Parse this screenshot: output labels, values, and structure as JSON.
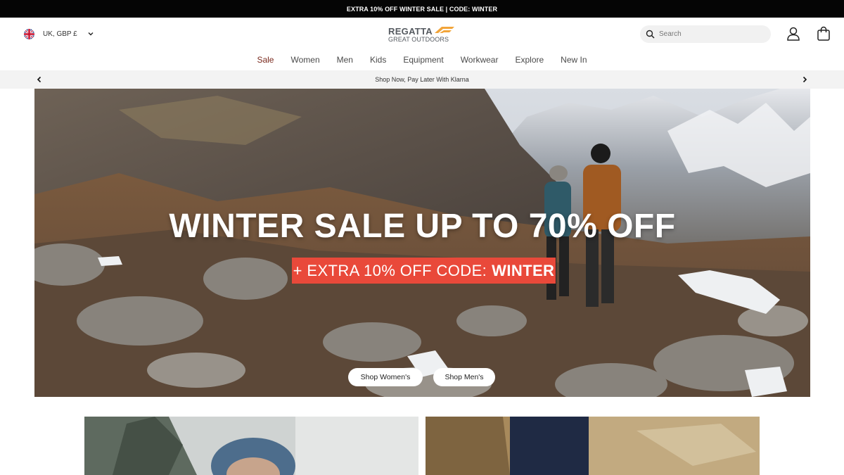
{
  "promo": {
    "text": "EXTRA 10% OFF WINTER SALE | CODE: WINTER"
  },
  "header": {
    "locale": "UK, GBP £",
    "logo": {
      "line1": "REGATTA",
      "line2": "GREAT OUTDOORS",
      "accent": "#f2a53a"
    },
    "search": {
      "placeholder": "Search",
      "value": ""
    }
  },
  "nav": {
    "items": [
      {
        "label": "Sale"
      },
      {
        "label": "Women"
      },
      {
        "label": "Men"
      },
      {
        "label": "Kids"
      },
      {
        "label": "Equipment"
      },
      {
        "label": "Workwear"
      },
      {
        "label": "Explore"
      },
      {
        "label": "New In"
      }
    ]
  },
  "banner": {
    "text": "Shop Now, Pay Later With Klarna"
  },
  "hero": {
    "title": "WINTER SALE UP TO 70% OFF",
    "code_prefix": "+ EXTRA 10% OFF CODE:",
    "code": "WINTER",
    "buttons": {
      "women": "Shop Women's",
      "men": "Shop Men's"
    }
  },
  "colors": {
    "promo_bg": "#050505",
    "sale_link": "#7a2a1e",
    "code_badge": "#e9493a",
    "banner_bg": "#f3f3f3"
  },
  "icons": [
    "uk-flag-icon",
    "chevron-down-icon",
    "search-icon",
    "account-icon",
    "bag-icon",
    "chevron-left-icon",
    "chevron-right-icon"
  ]
}
